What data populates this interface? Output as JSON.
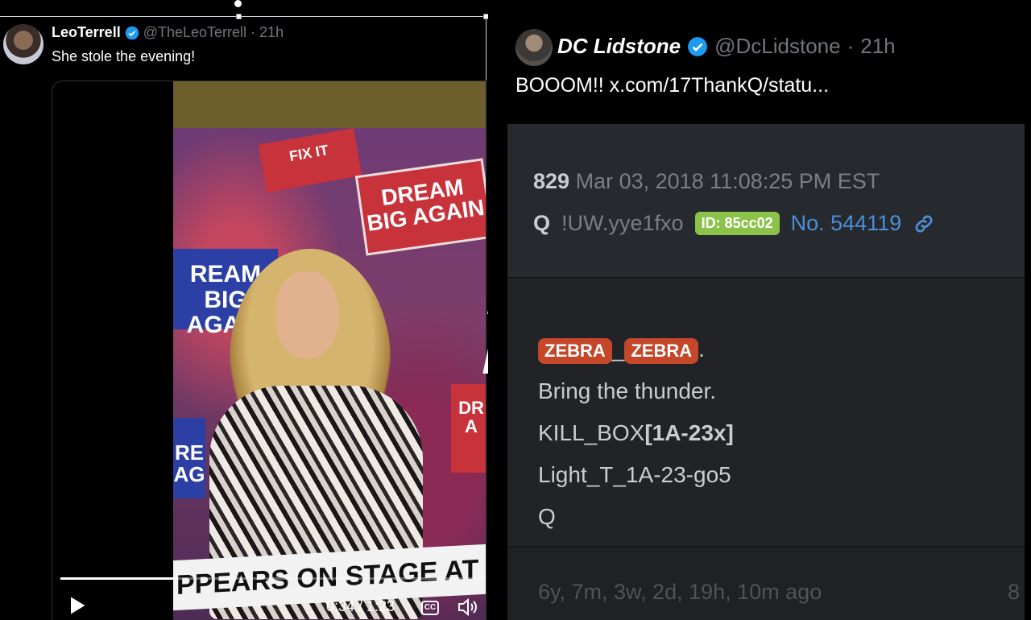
{
  "left_tweet": {
    "author_name": "LeoTerrell",
    "author_handle": "@TheLeoTerrell",
    "time": "21h",
    "text": "She stole the evening!",
    "video": {
      "sign_dream": "DREAM BIG AGAIN",
      "sign_fix": "FIX IT",
      "sign_blue": "REAM BIG AGAIN",
      "sign_blue2": "RE AG",
      "sign_red2": "DR A",
      "caption": "PPEARS ON STAGE AT MSG RALLY",
      "progress": 0.276,
      "time_display": "0:34 / 1:23",
      "cc_label": "CC"
    }
  },
  "right_tweet": {
    "author_name": "DC Lidstone",
    "author_handle": "@DcLidstone",
    "time": "21h",
    "text": "BOOOM!! x.com/17ThankQ/statu...",
    "q_post": {
      "number": "829",
      "timestamp": "Mar 03, 2018 11:08:25 PM EST",
      "poster": "Q",
      "tripcode": "!UW.yye1fxo",
      "id_badge": "ID: 85cc02",
      "post_no": "No. 544119",
      "tag1": "ZEBRA",
      "tag_sep": "_",
      "tag2": "ZEBRA",
      "tag_end": ".",
      "line1": "Bring the thunder.",
      "line2_prefix": "KILL_BOX",
      "line2_bold": "[1A-23x]",
      "line3": "Light_T_1A-23-go5",
      "line4": "Q",
      "ago": "6y, 7m, 3w, 2d, 19h, 10m ago",
      "edge_text": "8"
    }
  },
  "colors": {
    "verified": "#1d9bf0",
    "id_badge": "#8bc34a",
    "tag": "#c5472a",
    "post_link": "#4c8ed9"
  }
}
